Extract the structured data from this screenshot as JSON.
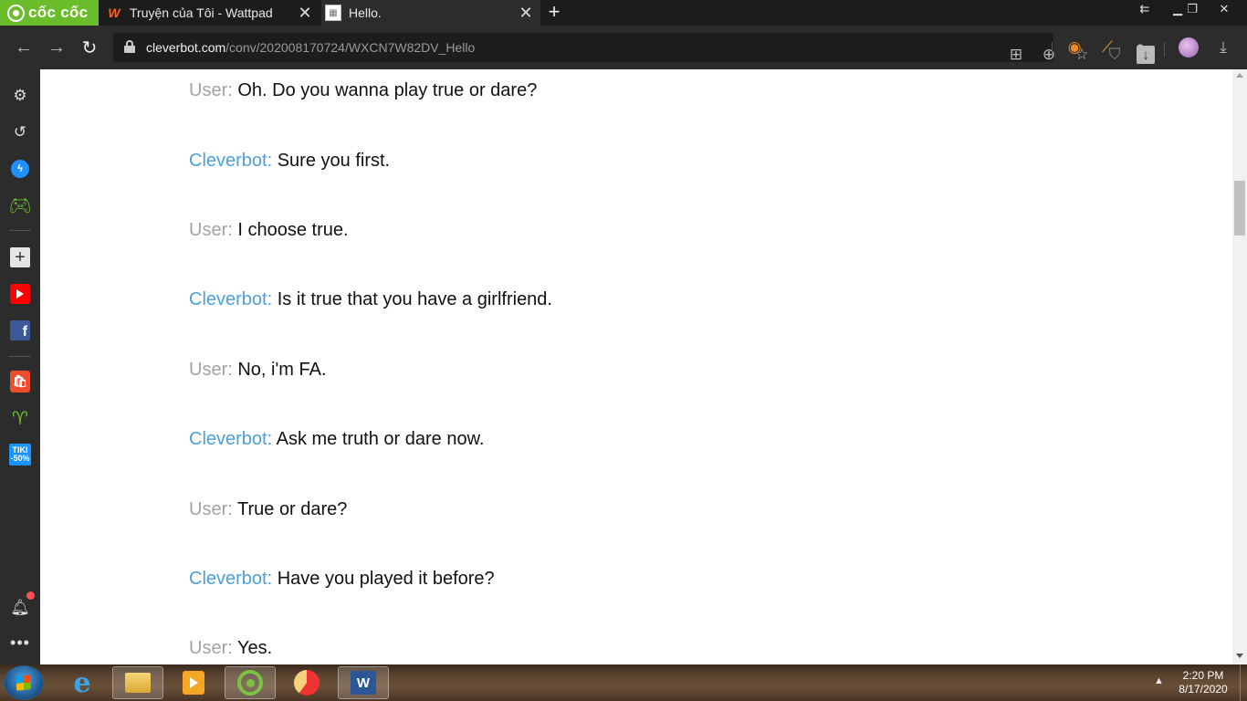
{
  "browser": {
    "brand": "cốc cốc",
    "tabs": [
      {
        "title": "Truyện của Tôi - Wattpad",
        "active": false
      },
      {
        "title": "Hello.",
        "active": true
      }
    ],
    "url": {
      "domain": "cleverbot.com",
      "path": "/conv/202008170724/WXCN7W82DV_Hello"
    }
  },
  "sidebar": {
    "items": [
      "gear-icon",
      "history-icon",
      "messenger-icon",
      "gamepad-icon",
      "add-icon",
      "youtube-icon",
      "facebook-icon",
      "shopee-icon",
      "coccoc-icon",
      "tiki-icon",
      "bell-icon",
      "more-icon"
    ],
    "facebook_glyph": "f",
    "tiki_label": "TIKI",
    "tiki_badge": "-50%"
  },
  "conversation": [
    {
      "speaker": "User:",
      "text": "Oh. Do you wanna play true or dare?"
    },
    {
      "speaker": "Cleverbot:",
      "text": "Sure you first."
    },
    {
      "speaker": "User:",
      "text": "I choose true."
    },
    {
      "speaker": "Cleverbot:",
      "text": "Is it true that you have a girlfriend."
    },
    {
      "speaker": "User:",
      "text": "No, i'm FA."
    },
    {
      "speaker": "Cleverbot:",
      "text": "Ask me truth or dare now."
    },
    {
      "speaker": "User:",
      "text": "True or dare?"
    },
    {
      "speaker": "Cleverbot:",
      "text": "Have you played it before?"
    },
    {
      "speaker": "User:",
      "text": "Yes."
    }
  ],
  "taskbar": {
    "apps": [
      "internet-explorer-icon",
      "file-explorer-icon",
      "media-player-icon",
      "coccoc-icon",
      "ccleaner-icon",
      "word-icon"
    ],
    "word_glyph": "W",
    "time": "2:20 PM",
    "date": "8/17/2020"
  },
  "colors": {
    "user_label": "#a3a3a3",
    "bot_label": "#4e9fd8",
    "brand_green": "#6cbd2c"
  }
}
